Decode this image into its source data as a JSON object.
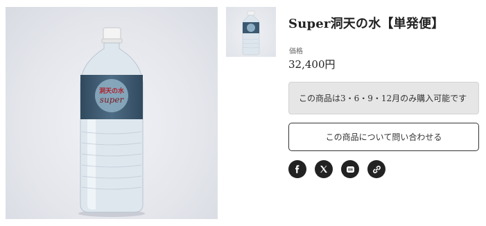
{
  "product": {
    "title": "Super洞天の水【単発便】",
    "price_label": "価格",
    "price": "32,400円",
    "notice": "この商品は3・6・9・12月のみ購入可能です",
    "contact_label": "この商品について問い合わせる"
  },
  "bottle_label": {
    "kanji": "洞天の水",
    "brand": "super"
  },
  "share": {
    "icons": [
      "facebook-icon",
      "x-icon",
      "line-icon",
      "link-icon"
    ]
  }
}
